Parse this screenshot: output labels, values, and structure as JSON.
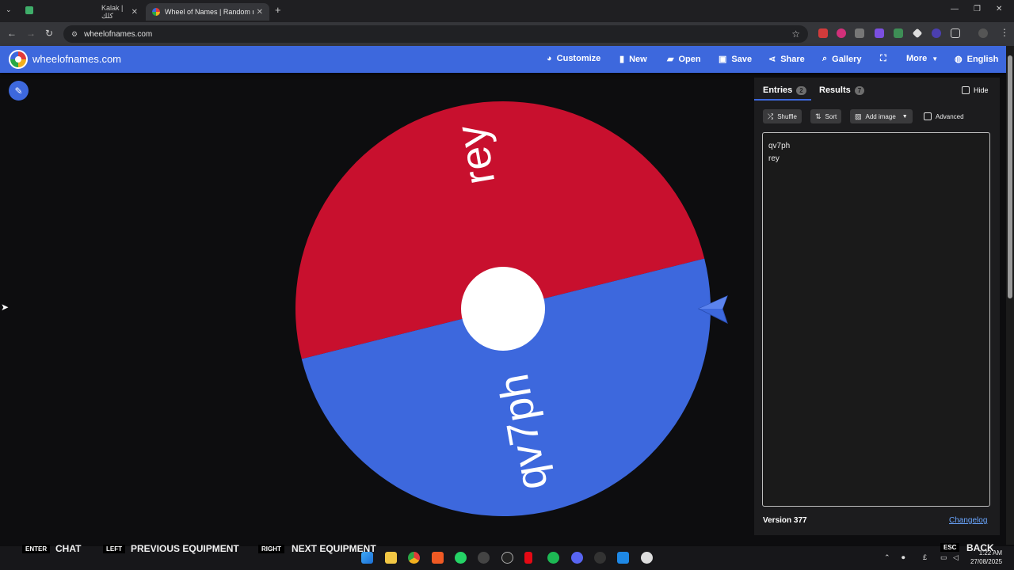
{
  "browser": {
    "tabs": [
      {
        "title": "Kalak | كلك",
        "active": false
      },
      {
        "title": "Wheel of Names | Random nam",
        "active": true
      }
    ],
    "url": "wheelofnames.com"
  },
  "site": {
    "name": "wheelofnames.com",
    "nav": {
      "customize": "Customize",
      "new": "New",
      "open": "Open",
      "save": "Save",
      "share": "Share",
      "gallery": "Gallery",
      "more": "More",
      "language": "English"
    }
  },
  "wheel": {
    "segments": [
      {
        "label": "rey",
        "color": "#c8102e"
      },
      {
        "label": "qv7ph",
        "color": "#3d68dd"
      }
    ]
  },
  "panel": {
    "entries_tab": "Entries",
    "entries_count": "2",
    "results_tab": "Results",
    "results_count": "7",
    "hide": "Hide",
    "shuffle": "Shuffle",
    "sort": "Sort",
    "add_image": "Add image",
    "advanced": "Advanced",
    "entries": [
      "qv7ph",
      "rey"
    ],
    "version": "Version 377",
    "changelog": "Changelog"
  },
  "overlay": {
    "prompts": [
      {
        "key": "ENTER",
        "label": "CHAT"
      },
      {
        "key": "LEFT",
        "label": "PREVIOUS EQUIPMENT"
      },
      {
        "key": "RIGHT",
        "label": "NEXT EQUIPMENT"
      },
      {
        "key": "ESC",
        "label": "BACK"
      }
    ]
  },
  "taskbar": {
    "time": "1:22 AM",
    "date": "27/08/2025",
    "tray_lang": "£"
  },
  "colors": {
    "accent": "#3d68dd",
    "red_segment": "#c8102e",
    "panel_bg": "#1c1c1e"
  }
}
